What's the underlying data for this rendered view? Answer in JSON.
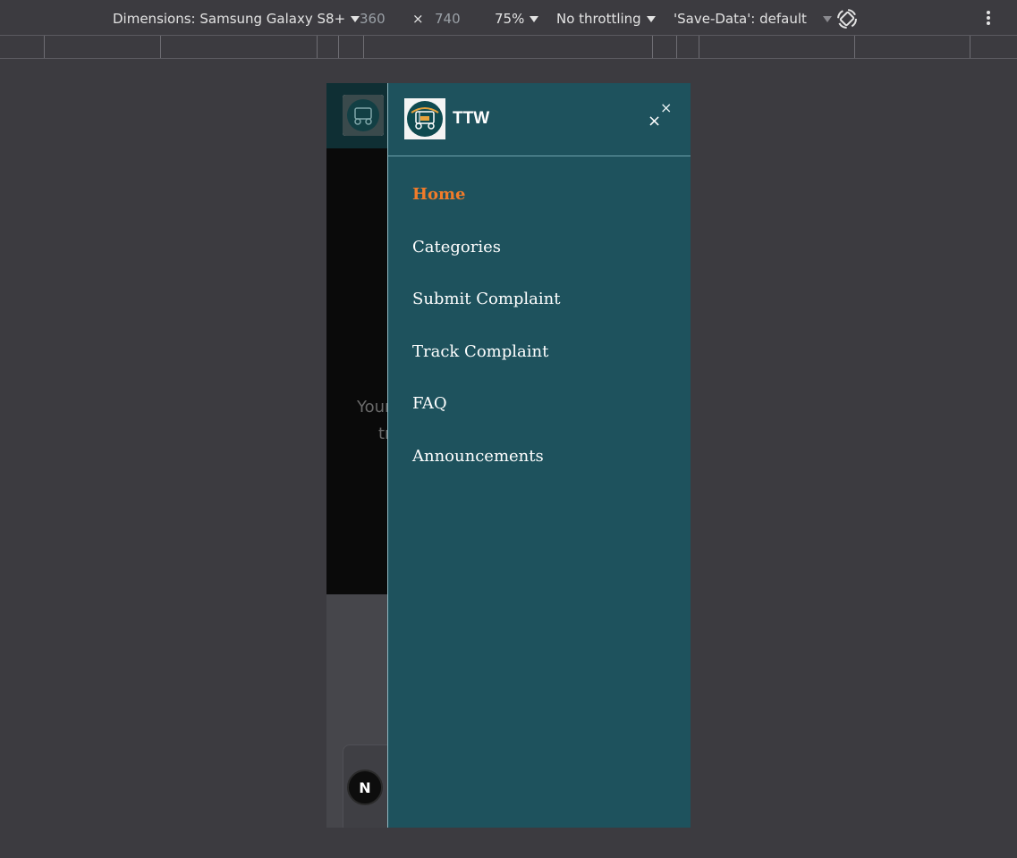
{
  "toolbar": {
    "device_label": "Dimensions: Samsung Galaxy S8+",
    "width": "360",
    "times": "×",
    "height": "740",
    "zoom": "75%",
    "throttling": "No throttling",
    "save_data": "'Save-Data': default"
  },
  "page": {
    "hero_text_line1": "Your",
    "hero_text_line2": "tr",
    "next_badge": "N"
  },
  "drawer": {
    "title": "TTW",
    "close_glyph": "×",
    "nav": [
      {
        "label": "Home",
        "active": true
      },
      {
        "label": "Categories"
      },
      {
        "label": "Submit Complaint"
      },
      {
        "label": "Track Complaint"
      },
      {
        "label": "FAQ"
      },
      {
        "label": "Announcements"
      }
    ]
  },
  "colors": {
    "drawer_bg": "#1e525d",
    "active_link": "#f07b2a"
  }
}
